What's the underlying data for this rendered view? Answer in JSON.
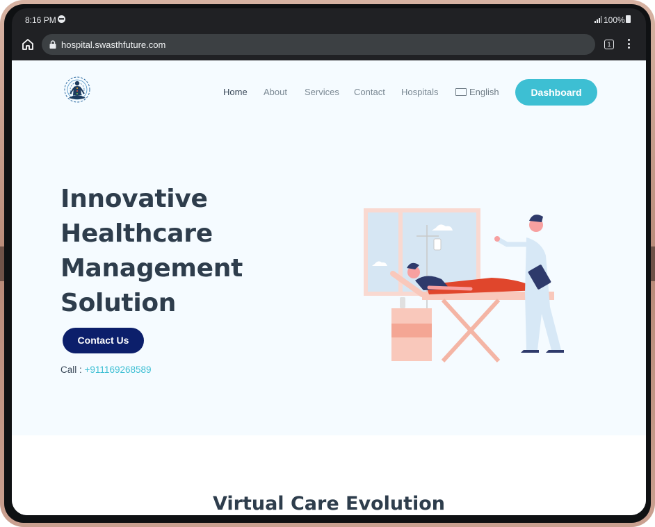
{
  "status_bar": {
    "time": "8:16 PM",
    "battery": "100%"
  },
  "browser": {
    "url": "hospital.swasthfuture.com",
    "tab_count": "1"
  },
  "nav": {
    "items": [
      "Home",
      "About",
      "Services",
      "Contact",
      "Hospitals"
    ],
    "language": "English",
    "dashboard_label": "Dashboard"
  },
  "hero": {
    "title_lines": [
      "Innovative",
      "Healthcare",
      "Management",
      "Solution"
    ],
    "contact_label": "Contact Us",
    "call_label": "Call :",
    "phone": "+911169268589"
  },
  "section2": {
    "title": "Virtual Care Evolution"
  },
  "colors": {
    "accent": "#3dbfd3",
    "primary_dark": "#0c1f6b",
    "heading": "#2e3d4c",
    "hero_bg": "#f5fbff"
  }
}
